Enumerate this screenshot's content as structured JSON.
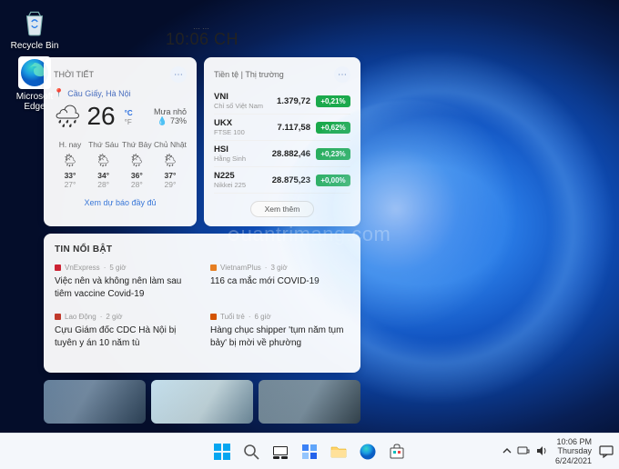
{
  "desktop_icons": {
    "recycle": "Recycle Bin",
    "edge": "Microsoft Edge"
  },
  "widgets": {
    "time": "10:06 CH",
    "weather": {
      "title": "THỜI TIẾT",
      "location": "Cầu Giấy, Hà Nội",
      "temp": "26",
      "unit_c": "°C",
      "unit_f": "°F",
      "condition": "Mưa nhỏ",
      "humidity": "73%",
      "forecast": [
        {
          "day": "H. nay",
          "icon": "🌦",
          "hi": "33°",
          "lo": "27°"
        },
        {
          "day": "Thứ Sáu",
          "icon": "🌦",
          "hi": "34°",
          "lo": "28°"
        },
        {
          "day": "Thứ Bảy",
          "icon": "🌦",
          "hi": "36°",
          "lo": "28°"
        },
        {
          "day": "Chủ Nhật",
          "icon": "🌦",
          "hi": "37°",
          "lo": "29°"
        }
      ],
      "full_link": "Xem dự báo đầy đủ"
    },
    "stocks": {
      "title": "Tiền tệ | Thị trường",
      "rows": [
        {
          "sym": "VNI",
          "sub": "Chỉ số Việt Nam",
          "val": "1.379,72",
          "chg": "+0,21%"
        },
        {
          "sym": "UKX",
          "sub": "FTSE 100",
          "val": "7.117,58",
          "chg": "+0,62%"
        },
        {
          "sym": "HSI",
          "sub": "Hằng Sinh",
          "val": "28.882,46",
          "chg": "+0,23%"
        },
        {
          "sym": "N225",
          "sub": "Nikkei 225",
          "val": "28.875,23",
          "chg": "+0,00%"
        }
      ],
      "see_more": "Xem thêm"
    },
    "news": {
      "title": "TIN NỔI BẬT",
      "items": [
        {
          "src": "VnExpress",
          "age": "5 giờ",
          "badge": "#c23",
          "title": "Việc nên và không nên làm sau tiêm vaccine Covid-19"
        },
        {
          "src": "VietnamPlus",
          "age": "3 giờ",
          "badge": "#e67e22",
          "title": "116 ca mắc mới COVID-19"
        },
        {
          "src": "Lao Động",
          "age": "2 giờ",
          "badge": "#c0392b",
          "title": "Cựu Giám đốc CDC Hà Nội bị tuyên y án 10 năm tù"
        },
        {
          "src": "Tuổi trẻ",
          "age": "6 giờ",
          "badge": "#d35400",
          "title": "Hàng chục shipper 'tụm năm tụm bảy' bị mời về phường"
        }
      ]
    }
  },
  "taskbar": {
    "clock_time": "10:06 PM",
    "clock_day": "Thursday",
    "clock_date": "6/24/2021"
  },
  "watermark": "uantrimang.com"
}
